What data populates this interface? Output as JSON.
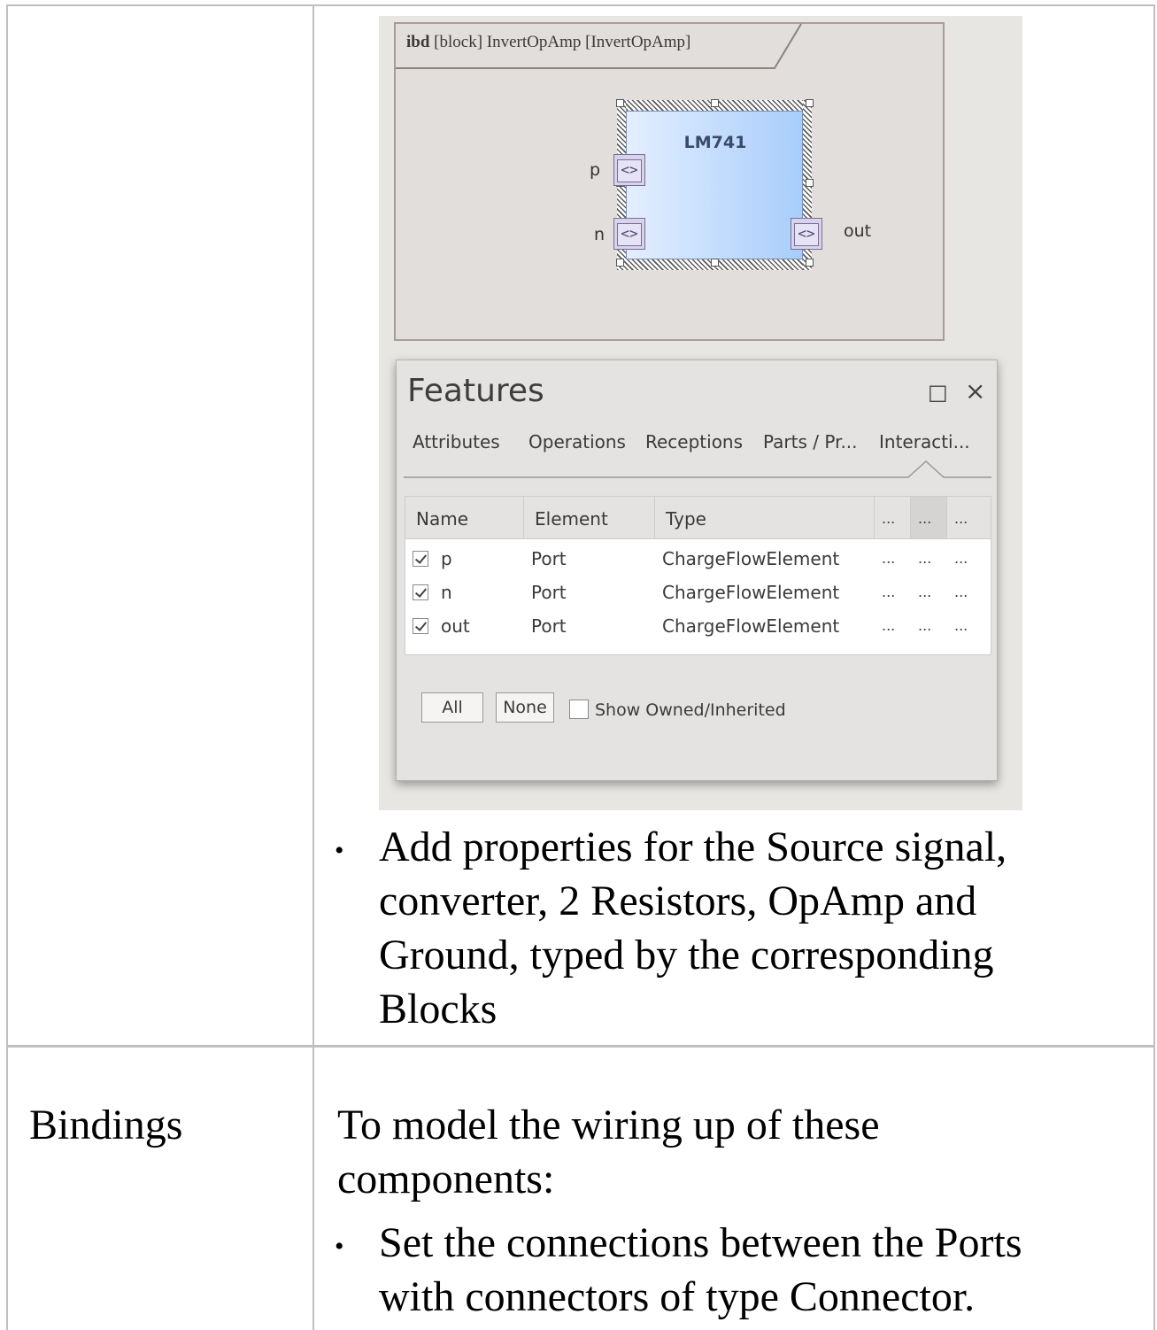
{
  "diagram": {
    "frame_kind": "ibd",
    "frame_title": "[block] InvertOpAmp [InvertOpAmp]",
    "block_name": "LM741",
    "port_glyph": "<>",
    "ports": [
      {
        "label": "p"
      },
      {
        "label": "n"
      },
      {
        "label": "out"
      }
    ]
  },
  "features_window": {
    "title": "Features",
    "maximize_icon": "□",
    "close_icon": "×",
    "tabs": [
      "Attributes",
      "Operations",
      "Receptions",
      "Parts / Pr...",
      "Interacti..."
    ],
    "columns": [
      "Name",
      "Element",
      "Type",
      "...",
      "...",
      "..."
    ],
    "rows": [
      {
        "checked": true,
        "name": "p",
        "element": "Port",
        "type": "ChargeFlowElement",
        "c1": "...",
        "c2": "...",
        "c3": "..."
      },
      {
        "checked": true,
        "name": "n",
        "element": "Port",
        "type": "ChargeFlowElement",
        "c1": "...",
        "c2": "...",
        "c3": "..."
      },
      {
        "checked": true,
        "name": "out",
        "element": "Port",
        "type": "ChargeFlowElement",
        "c1": "...",
        "c2": "...",
        "c3": "..."
      }
    ],
    "all_button": "All",
    "none_button": "None",
    "show_owned_label": "Show Owned/Inherited",
    "show_owned_checked": false
  },
  "doc": {
    "bullet_char": "•",
    "bullet1_lines": [
      "Add properties for the Source signal,",
      "converter, 2 Resistors, OpAmp and",
      "Ground, typed by the corresponding",
      "Blocks"
    ],
    "row2_label": "Bindings",
    "row2_intro_lines": [
      "To model the wiring up of these",
      "components:"
    ],
    "bullet2_lines": [
      "Set the connections between the Ports",
      "with connectors of type Connector."
    ]
  }
}
